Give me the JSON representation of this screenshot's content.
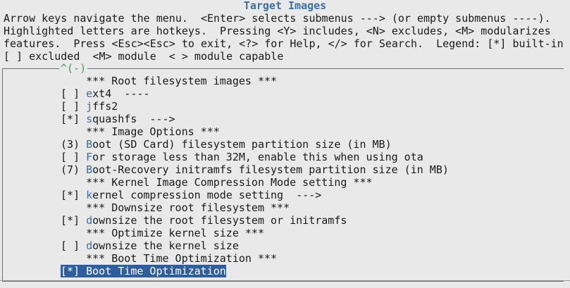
{
  "window": {
    "title": "Target Images"
  },
  "help_lines": [
    "Arrow keys navigate the menu.  <Enter> selects submenus ---> (or empty submenus ----).",
    "Highlighted letters are hotkeys.  Pressing <Y> includes, <N> excludes, <M> modularizes",
    "features.  Press <Esc><Esc> to exit, <?> for Help, </> for Search.  Legend: [*] built-in",
    "[ ] excluded  <M> module  < > module capable"
  ],
  "scroll_marker": "^(-)",
  "menu": [
    {
      "prefix": "",
      "hot": "",
      "text": "    *** Root filesystem images ***"
    },
    {
      "prefix": "[ ] ",
      "hot": "e",
      "text": "xt4  ----"
    },
    {
      "prefix": "[ ] ",
      "hot": "j",
      "text": "ffs2"
    },
    {
      "prefix": "[*] ",
      "hot": "s",
      "text": "quashfs  --->"
    },
    {
      "prefix": "",
      "hot": "",
      "text": "    *** Image Options ***"
    },
    {
      "prefix": "(3) ",
      "hot": "B",
      "text": "oot (SD Card) filesystem partition size (in MB)"
    },
    {
      "prefix": "[ ] ",
      "hot": "F",
      "text": "or storage less than 32M, enable this when using ota"
    },
    {
      "prefix": "(7) ",
      "hot": "B",
      "text": "oot-Recovery initramfs filesystem partition size (in MB)"
    },
    {
      "prefix": "",
      "hot": "",
      "text": "    *** Kernel Image Compression Mode setting ***"
    },
    {
      "prefix": "[*] ",
      "hot": "k",
      "text": "ernel compression mode setting  --->"
    },
    {
      "prefix": "",
      "hot": "",
      "text": "    *** Downsize root filesystem ***"
    },
    {
      "prefix": "[*] ",
      "hot": "d",
      "text": "ownsize the root filesystem or initramfs"
    },
    {
      "prefix": "",
      "hot": "",
      "text": "    *** Optimize kernel size ***"
    },
    {
      "prefix": "[ ] ",
      "hot": "d",
      "text": "ownsize the kernel size"
    },
    {
      "prefix": "",
      "hot": "",
      "text": "    *** Boot Time Optimization ***"
    },
    {
      "prefix": "[*] ",
      "hot": "B",
      "text": "oot Time Optimization",
      "selected": true
    }
  ]
}
